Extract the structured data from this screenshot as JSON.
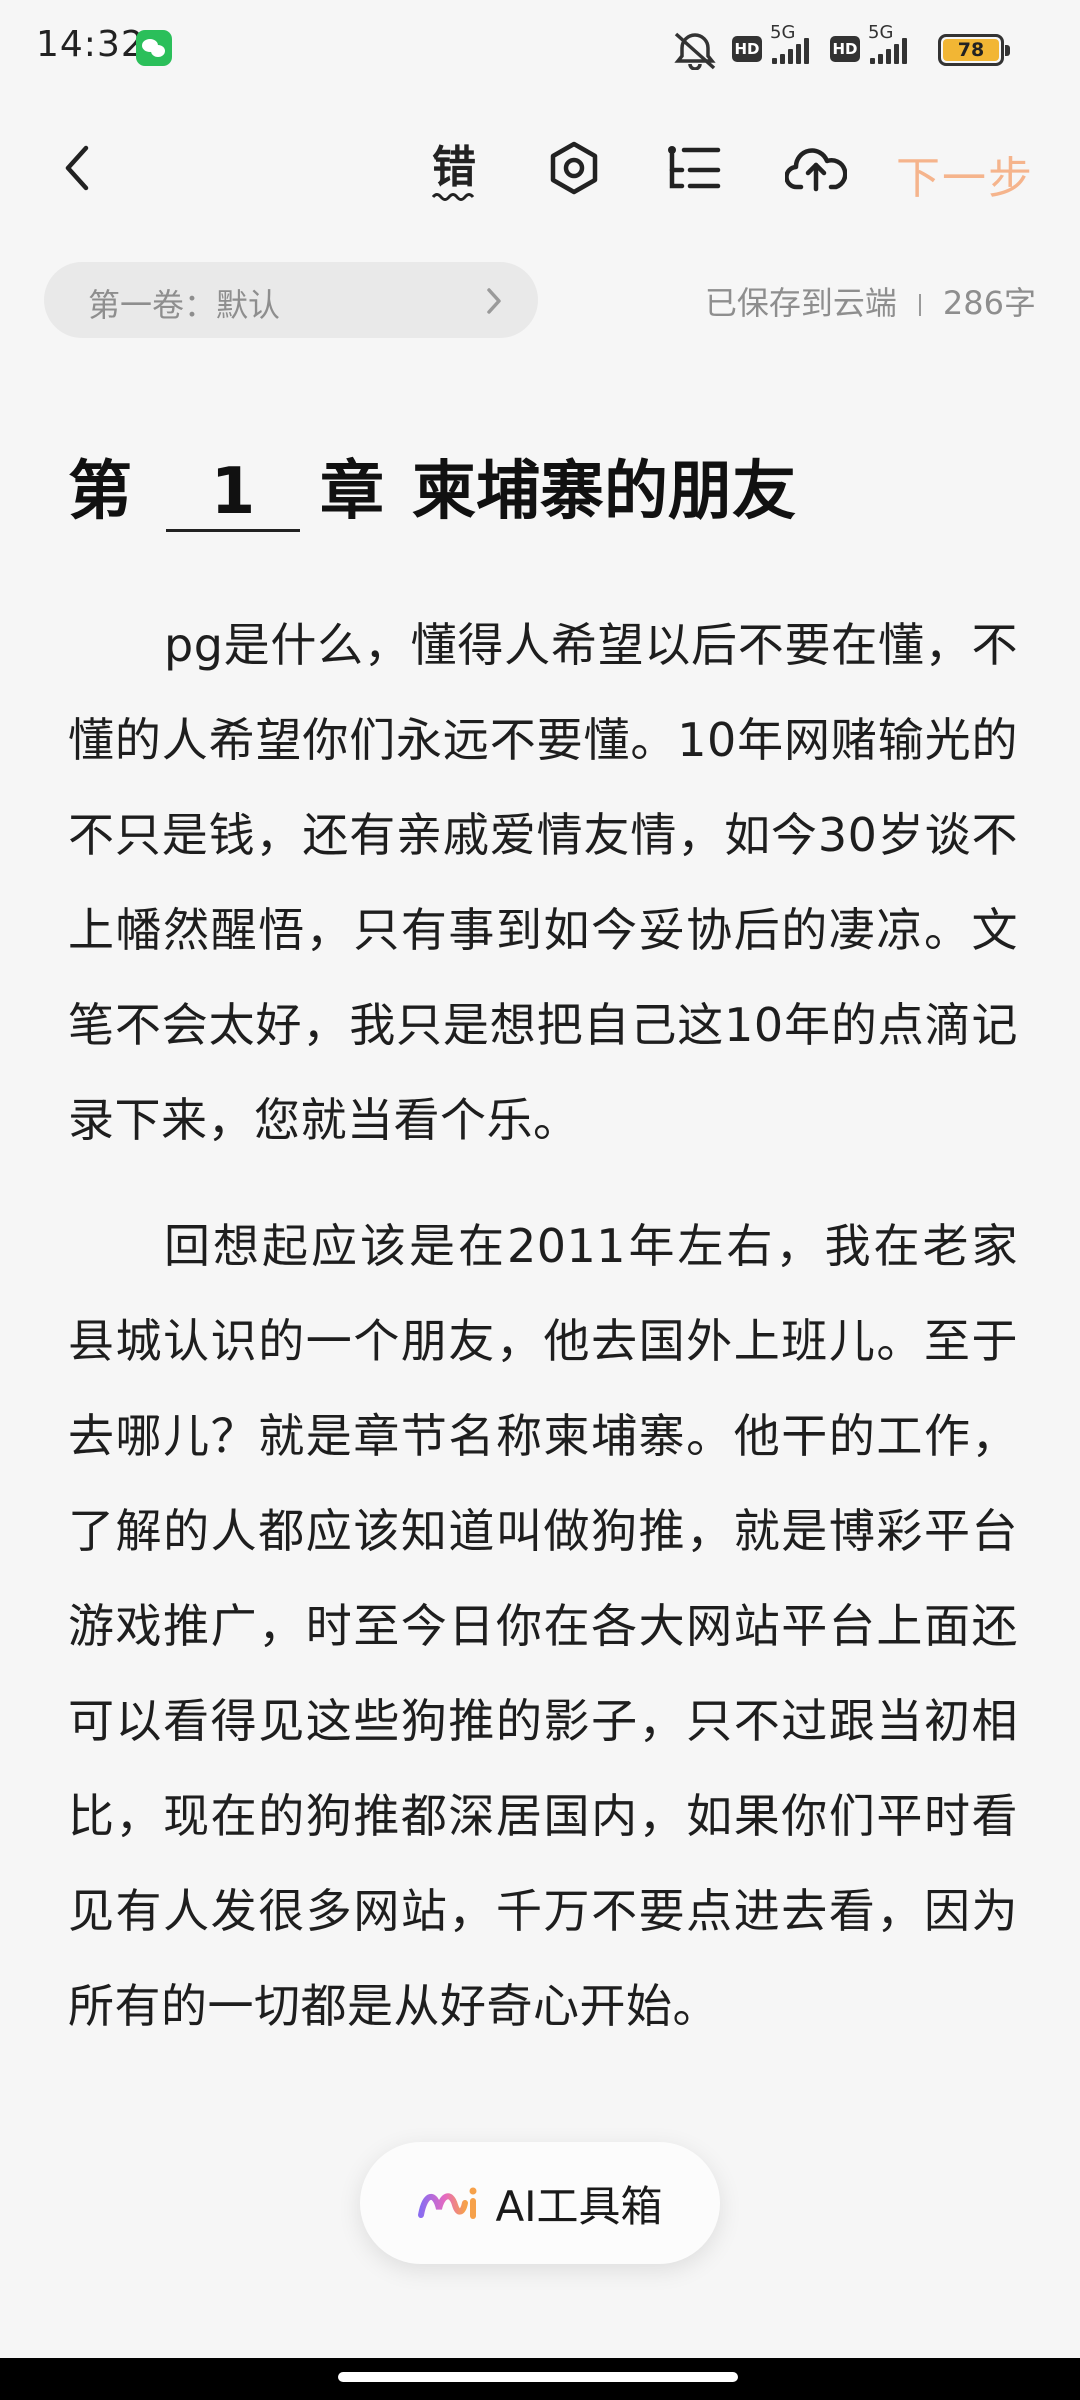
{
  "status_bar": {
    "time": "14:32",
    "app_icon": "wechat-icon",
    "mute_icon": "vibrate-off-icon",
    "sim1": {
      "hd": "HD",
      "network": "5G"
    },
    "sim2": {
      "hd": "HD",
      "network": "5G"
    },
    "battery_level": "78",
    "battery_color": "#f2b634"
  },
  "toolbar": {
    "back_icon": "chevron-left-icon",
    "typo_check_label": "错",
    "settings_icon": "hexagon-settings-icon",
    "outline_icon": "list-icon",
    "upload_icon": "cloud-upload-icon",
    "next_label": "下一步",
    "next_color": "#f5b48c"
  },
  "volume": {
    "label": "第一卷：默认",
    "chevron_icon": "chevron-right-icon"
  },
  "save_status": {
    "text": "已保存到云端",
    "word_count": "286字"
  },
  "chapter": {
    "prefix": "第",
    "number": "1",
    "suffix": "章",
    "title": "柬埔寨的朋友"
  },
  "paragraphs": [
    "pg是什么，懂得人希望以后不要在懂，不懂的人希望你们永远不要懂。10年网赌输光的不只是钱，还有亲戚爱情友情，如今30岁谈不上幡然醒悟，只有事到如今妥协后的凄凉。文笔不会太好，我只是想把自己这10年的点滴记录下来，您就当看个乐。",
    "回想起应该是在2011年左右，我在老家县城认识的一个朋友，他去国外上班儿。至于去哪儿？就是章节名称柬埔寨。他干的工作，了解的人都应该知道叫做狗推，就是博彩平台游戏推广，时至今日你在各大网站平台上面还可以看得见这些狗推的影子，只不过跟当初相比，现在的狗推都深居国内，如果你们平时看见有人发很多网站，千万不要点进去看，因为所有的一切都是从好奇心开始。"
  ],
  "ai_toolbox": {
    "label": "AI工具箱",
    "icon": "ai-logo-icon"
  }
}
